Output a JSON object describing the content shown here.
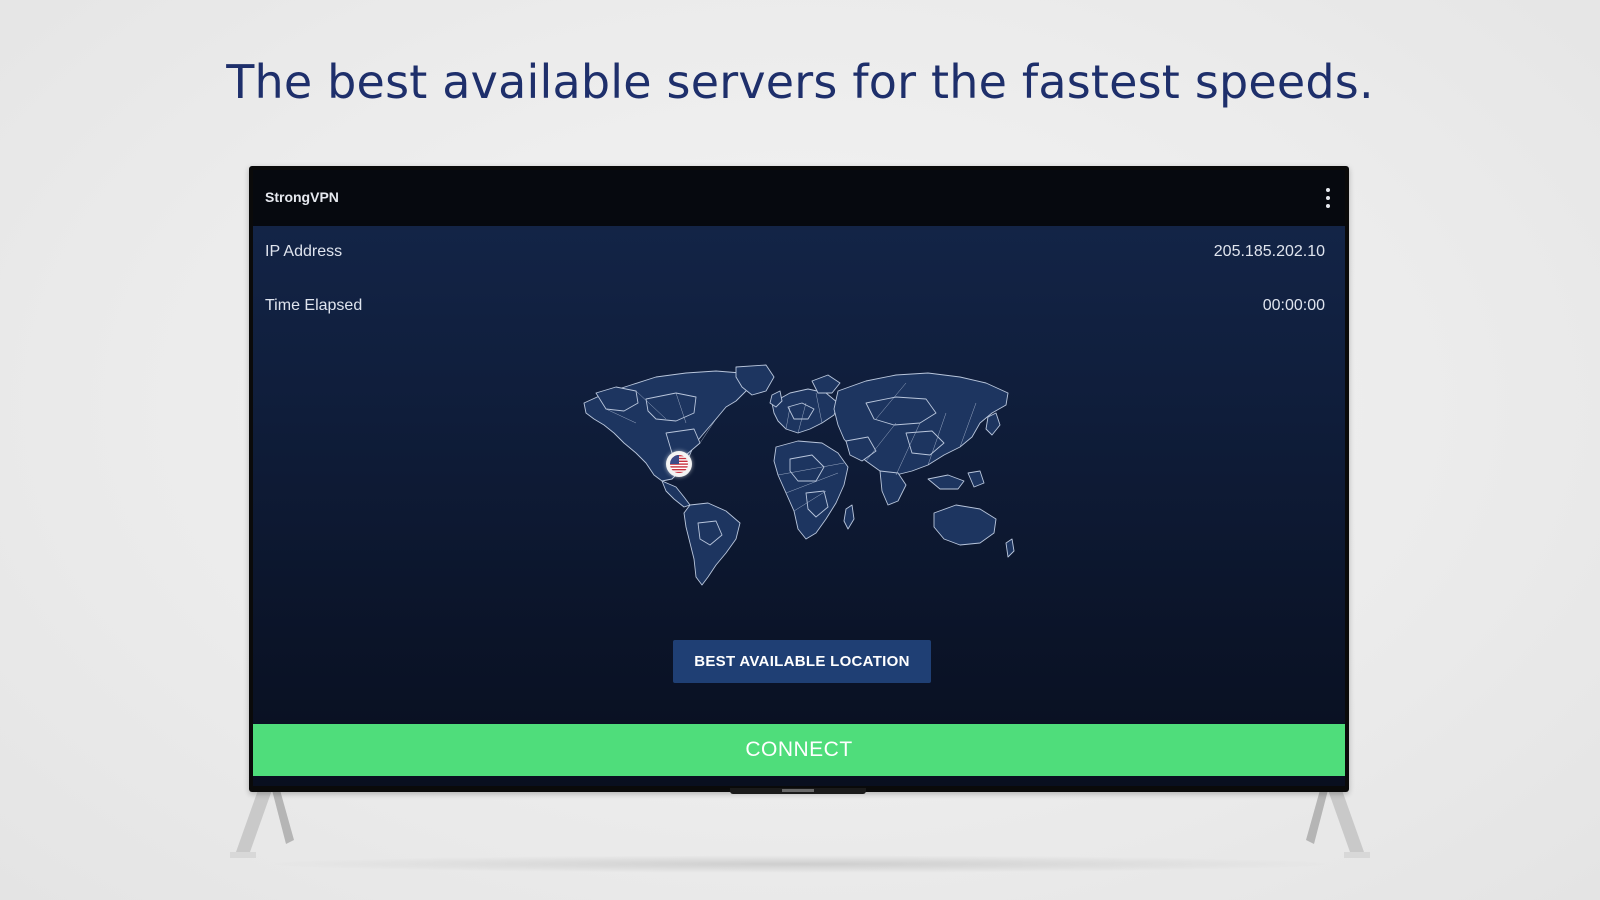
{
  "headline": "The best available servers for the fastest speeds.",
  "app": {
    "title": "StrongVPN",
    "menu_icon": "more-vert-icon"
  },
  "info": {
    "ip_label": "IP Address",
    "ip_value": "205.185.202.10",
    "time_label": "Time Elapsed",
    "time_value": "00:00:00"
  },
  "map": {
    "selected_location_flag": "us-flag-icon"
  },
  "buttons": {
    "best_location": "BEST AVAILABLE LOCATION",
    "connect": "CONNECT"
  },
  "colors": {
    "headline": "#1e2f6b",
    "connect": "#4fdd7b",
    "best_location": "#1f3f74",
    "screen_bg": "#0f1d3a"
  }
}
